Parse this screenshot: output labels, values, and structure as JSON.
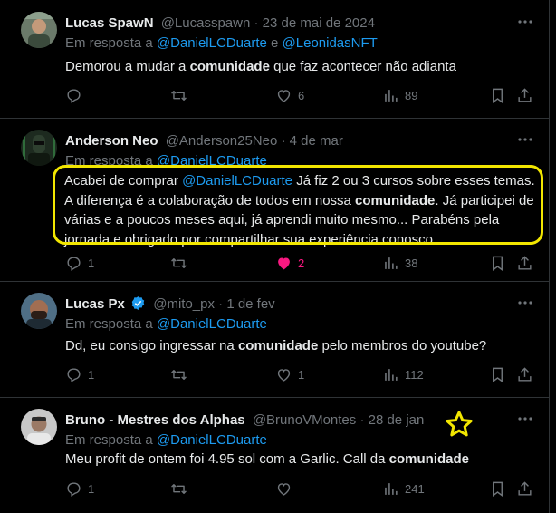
{
  "tweets": [
    {
      "name": "Lucas SpawN",
      "handle": "@Lucasspawn",
      "separator": "·",
      "date": "23 de mai de 2024",
      "reply_prefix": "Em resposta a ",
      "reply_user1": "@DanielLCDuarte",
      "reply_join": " e ",
      "reply_user2": "@LeonidasNFT",
      "text_1": "Demorou a mudar a ",
      "text_bold": "comunidade",
      "text_2": " que faz acontecer não adianta",
      "replies": "",
      "retweets": "",
      "likes": "6",
      "views": "89"
    },
    {
      "name": "Anderson Neo",
      "handle": "@Anderson25Neo",
      "separator": "·",
      "date": "4 de mar",
      "reply_prefix": "Em resposta a ",
      "reply_user1": "@DanielLCDuarte",
      "text_1": "Acabei de comprar ",
      "text_mention": "@DanielLCDuarte",
      "text_2": " Já fiz 2 ou 3 cursos sobre esses temas. A diferença é a colaboração de todos em nossa ",
      "text_bold": "comunidade",
      "text_3": ". Já participei de várias e a poucos meses aqui, já aprendi muito mesmo... Parabéns pela jornada e obrigado por compartilhar sua experiência conosco",
      "replies": "1",
      "retweets": "",
      "likes": "2",
      "views": "38"
    },
    {
      "name": "Lucas Px",
      "handle": "@mito_px",
      "separator": "·",
      "date": "1 de fev",
      "reply_prefix": "Em resposta a ",
      "reply_user1": "@DanielLCDuarte",
      "text_1": "Dd, eu consigo ingressar na ",
      "text_bold": "comunidade",
      "text_2": " pelo membros do youtube?",
      "replies": "1",
      "retweets": "",
      "likes": "1",
      "views": "112"
    },
    {
      "name": "Bruno - Mestres dos Alphas",
      "handle": "@BrunoVMontes",
      "separator": "·",
      "date": "28 de jan",
      "reply_prefix": "Em resposta a ",
      "reply_user1": "@DanielLCDuarte",
      "text_1": "Meu profit de ontem foi 4.95 sol com a Garlic. Call da ",
      "text_bold": "comunidade",
      "text_2": "",
      "replies": "1",
      "retweets": "",
      "likes": "",
      "views": "241"
    }
  ],
  "colors": {
    "background": "#000000",
    "text": "#e7e9ea",
    "muted": "#71767b",
    "link": "#1d9bf0",
    "like_active": "#f91880",
    "annotation": "#f2e600",
    "verified": "#1d9bf0"
  },
  "icons": [
    "reply-icon",
    "retweet-icon",
    "like-icon",
    "views-icon",
    "bookmark-icon",
    "share-icon",
    "more-icon",
    "verified-badge-icon",
    "star-annotation-icon"
  ]
}
